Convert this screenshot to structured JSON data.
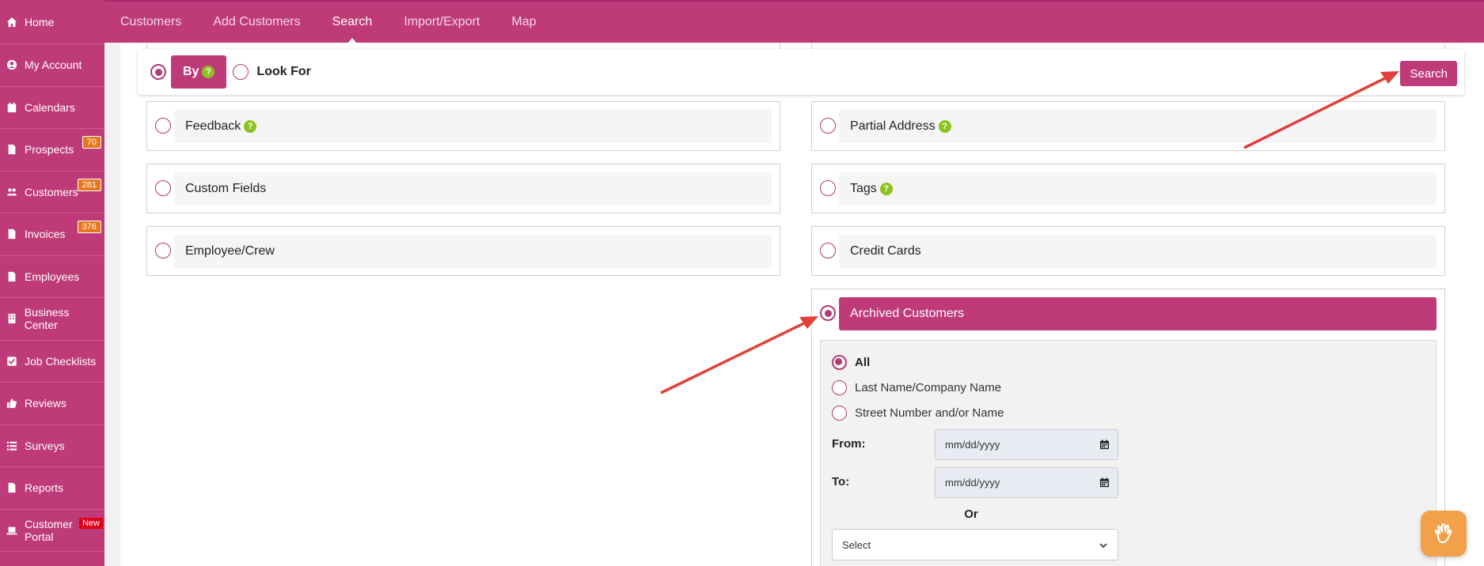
{
  "sidebar": {
    "items": [
      {
        "label": "Home",
        "icon": "home-icon"
      },
      {
        "label": "My Account",
        "icon": "user-circle-icon"
      },
      {
        "label": "Calendars",
        "icon": "calendar-icon"
      },
      {
        "label": "Prospects",
        "icon": "file-icon",
        "badge": "70"
      },
      {
        "label": "Customers",
        "icon": "users-icon",
        "badge": "281"
      },
      {
        "label": "Invoices",
        "icon": "file-icon",
        "badge": "376"
      },
      {
        "label": "Employees",
        "icon": "file-icon"
      },
      {
        "label": "Business Center",
        "icon": "building-icon"
      },
      {
        "label": "Job Checklists",
        "icon": "checkbox-icon"
      },
      {
        "label": "Reviews",
        "icon": "thumbs-up-icon"
      },
      {
        "label": "Surveys",
        "icon": "list-icon"
      },
      {
        "label": "Reports",
        "icon": "file-icon"
      },
      {
        "label": "Customer Portal",
        "icon": "laptop-icon",
        "badge": "New"
      }
    ]
  },
  "topnav": {
    "tabs": [
      "Customers",
      "Add Customers",
      "Search",
      "Import/Export",
      "Map"
    ],
    "active": "Search"
  },
  "searchbar": {
    "by_label": "By",
    "lookfor_label": "Look For",
    "search_button": "Search",
    "help_glyph": "?"
  },
  "options": {
    "feedback": "Feedback",
    "partial_address": "Partial Address",
    "custom_fields": "Custom Fields",
    "tags": "Tags",
    "employee_crew": "Employee/Crew",
    "credit_cards": "Credit Cards"
  },
  "archived": {
    "title": "Archived Customers",
    "sub_options": [
      "All",
      "Last Name/Company Name",
      "Street Number and/or Name"
    ],
    "selected": "All",
    "from_label": "From:",
    "to_label": "To:",
    "date_placeholder": "mm/dd/yyyy",
    "or_label": "Or",
    "select_value": "Select"
  },
  "colors": {
    "brand": "#bf3a78",
    "badge": "#e8781e",
    "help": "#8dc21f",
    "arrow": "#e0413a"
  }
}
